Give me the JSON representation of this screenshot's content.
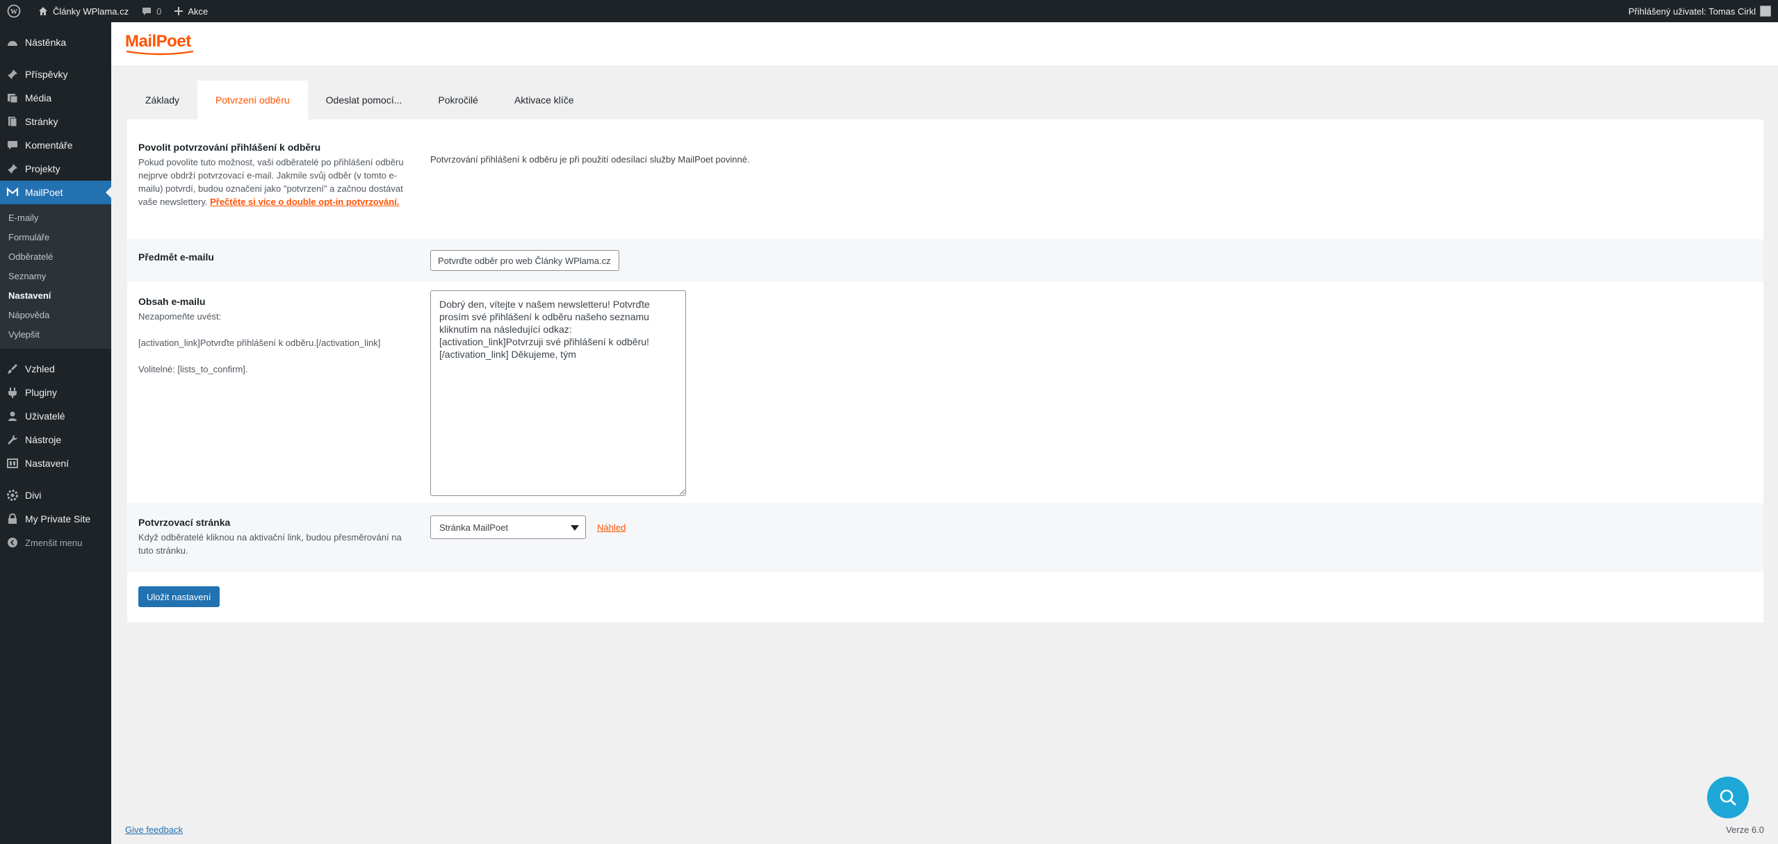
{
  "adminbar": {
    "site_name": "Články WPlama.cz",
    "comments_count": "0",
    "new_label": "Akce",
    "user_greeting": "Přihlášený uživatel: Tomas Cirkl"
  },
  "sidebar": {
    "items_top": [
      {
        "label": "Nástěnka",
        "icon": "dashboard-icon"
      }
    ],
    "items_mid": [
      {
        "label": "Příspěvky",
        "icon": "pin-icon"
      },
      {
        "label": "Média",
        "icon": "media-icon"
      },
      {
        "label": "Stránky",
        "icon": "pages-icon"
      },
      {
        "label": "Komentáře",
        "icon": "comments-icon"
      },
      {
        "label": "Projekty",
        "icon": "pin-icon"
      }
    ],
    "active": {
      "label": "MailPoet",
      "icon": "mailpoet-icon"
    },
    "submenu": [
      "E-maily",
      "Formuláře",
      "Odběratelé",
      "Seznamy",
      "Nastavení",
      "Nápověda",
      "Vylepšit"
    ],
    "items_bottom": [
      {
        "label": "Vzhled",
        "icon": "brush-icon"
      },
      {
        "label": "Pluginy",
        "icon": "plugin-icon"
      },
      {
        "label": "Uživatelé",
        "icon": "users-icon"
      },
      {
        "label": "Nástroje",
        "icon": "tools-icon"
      },
      {
        "label": "Nastavení",
        "icon": "settings-icon"
      }
    ],
    "items_extra": [
      {
        "label": "Divi",
        "icon": "gear-icon"
      },
      {
        "label": "My Private Site",
        "icon": "lock-icon"
      }
    ],
    "collapse_label": "Zmenšit menu"
  },
  "logo": {
    "text": "MailPoet"
  },
  "tabs": [
    "Základy",
    "Potvrzení odběru",
    "Odeslat pomocí...",
    "Pokročilé",
    "Aktivace klíče"
  ],
  "settings": {
    "enable": {
      "title": "Povolit potvrzování přihlášení k odběru",
      "desc": "Pokud povolíte tuto možnost, vaši odběratelé po přihlášení odběru nejprve obdrží potvrzovací e-mail. Jakmile svůj odběr (v tomto e-mailu) potvrdí, budou označeni jako \"potvrzení\" a začnou dostávat vaše newslettery.",
      "link": "Přečtěte si více o double opt-in potvrzování.",
      "value_text": "Potvrzování přihlášení k odběru je při použití odesílací služby MailPoet povinné."
    },
    "subject": {
      "title": "Předmět e-mailu",
      "value": "Potvrďte odběr pro web Články WPlama.cz"
    },
    "content": {
      "title": "Obsah e-mailu",
      "note": "Nezapomeňte uvést:",
      "activation": "[activation_link]Potvrďte přihlášení k odběru.[/activation_link]",
      "optional": "Volitelné: [lists_to_confirm].",
      "value": "Dobrý den, vítejte v našem newsletteru! Potvrďte prosím své přihlášení k odběru našeho seznamu kliknutím na následující odkaz: [activation_link]Potvrzuji své přihlášení k odběru! [/activation_link] Děkujeme, tým"
    },
    "page": {
      "title": "Potvrzovací stránka",
      "desc": "Když odběratelé kliknou na aktivační link, budou přesměrování na tuto stránku.",
      "selected": "Stránka MailPoet",
      "preview": "Náhled"
    },
    "save_label": "Uložit nastavení"
  },
  "footer": {
    "feedback": "Give feedback",
    "version": "Verze 6.0"
  },
  "colors": {
    "accent": "#ff5301",
    "primary": "#2271b1",
    "sidebar_bg": "#1d2327"
  }
}
